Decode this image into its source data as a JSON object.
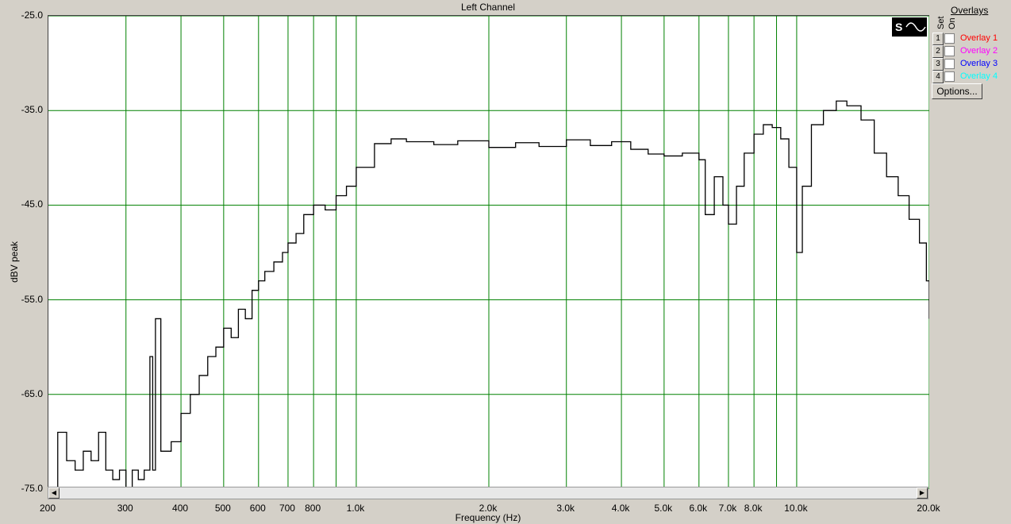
{
  "chart_data": {
    "type": "line",
    "title": "Left Channel",
    "xlabel": "Frequency (Hz)",
    "ylabel": "dBV peak",
    "xscale": "log",
    "xlim": [
      200,
      20000
    ],
    "ylim": [
      -75.0,
      -25.0
    ],
    "yticks": [
      "-25.0",
      "-35.0",
      "-45.0",
      "-55.0",
      "-65.0",
      "-75.0"
    ],
    "ytick_values": [
      -25,
      -35,
      -45,
      -55,
      -65,
      -75
    ],
    "xticks": [
      {
        "v": 200,
        "label": "200"
      },
      {
        "v": 300,
        "label": "300"
      },
      {
        "v": 400,
        "label": "400"
      },
      {
        "v": 500,
        "label": "500"
      },
      {
        "v": 600,
        "label": "600"
      },
      {
        "v": 700,
        "label": "700"
      },
      {
        "v": 800,
        "label": "800"
      },
      {
        "v": 1000,
        "label": "1.0k"
      },
      {
        "v": 2000,
        "label": "2.0k"
      },
      {
        "v": 3000,
        "label": "3.0k"
      },
      {
        "v": 4000,
        "label": "4.0k"
      },
      {
        "v": 5000,
        "label": "5.0k"
      },
      {
        "v": 6000,
        "label": "6.0k"
      },
      {
        "v": 7000,
        "label": "7.0k"
      },
      {
        "v": 8000,
        "label": "8.0k"
      },
      {
        "v": 10000,
        "label": "10.0k"
      },
      {
        "v": 20000,
        "label": "20.0k"
      }
    ],
    "gridlines_x": [
      300,
      400,
      500,
      600,
      700,
      800,
      900,
      1000,
      2000,
      3000,
      4000,
      5000,
      6000,
      7000,
      8000,
      9000,
      10000,
      20000
    ],
    "grid": true,
    "series": [
      {
        "color": "#000000",
        "x": [
          200,
          210,
          220,
          230,
          240,
          250,
          260,
          270,
          280,
          290,
          300,
          310,
          320,
          330,
          340,
          345,
          350,
          360,
          380,
          400,
          420,
          440,
          460,
          480,
          500,
          520,
          540,
          560,
          580,
          600,
          620,
          650,
          680,
          700,
          730,
          760,
          800,
          850,
          900,
          950,
          1000,
          1100,
          1200,
          1300,
          1500,
          1700,
          2000,
          2300,
          2600,
          3000,
          3400,
          3800,
          4200,
          4600,
          5000,
          5500,
          6000,
          6200,
          6500,
          6800,
          7000,
          7300,
          7600,
          8000,
          8400,
          8800,
          9200,
          9600,
          10000,
          10300,
          10800,
          11500,
          12300,
          13000,
          14000,
          15000,
          16000,
          17000,
          18000,
          19000,
          19700,
          20000
        ],
        "y": [
          -75,
          -69,
          -72,
          -73,
          -71,
          -72,
          -69,
          -73,
          -74,
          -73,
          -75,
          -73,
          -74,
          -73,
          -61,
          -73,
          -57,
          -71,
          -70,
          -67,
          -65,
          -63,
          -61,
          -60,
          -58,
          -59,
          -56,
          -57,
          -54,
          -53,
          -52,
          -51,
          -50,
          -49,
          -48,
          -46,
          -45,
          -45.5,
          -44,
          -43,
          -41,
          -38.5,
          -38,
          -38.3,
          -38.6,
          -38.2,
          -38.9,
          -38.4,
          -38.8,
          -38.1,
          -38.7,
          -38.3,
          -39.1,
          -39.6,
          -39.8,
          -39.5,
          -40.2,
          -46,
          -42,
          -45,
          -47,
          -43,
          -39.5,
          -37.5,
          -36.5,
          -36.8,
          -38,
          -41,
          -50,
          -43,
          -36.5,
          -35,
          -34,
          -34.5,
          -36,
          -39.5,
          -42,
          -44,
          -46.5,
          -49,
          -53,
          -57
        ]
      }
    ]
  },
  "panel": {
    "overlays_title": "Overlays",
    "set_label": "Set",
    "on_label": "On",
    "items": [
      {
        "num": "1",
        "label": "Overlay 1",
        "color": "#ff0000"
      },
      {
        "num": "2",
        "label": "Overlay 2",
        "color": "#ff00ff"
      },
      {
        "num": "3",
        "label": "Overlay 3",
        "color": "#0000ff"
      },
      {
        "num": "4",
        "label": "Overlay 4",
        "color": "#00ffff"
      }
    ],
    "options_label": "Options..."
  },
  "logo_text": "S"
}
